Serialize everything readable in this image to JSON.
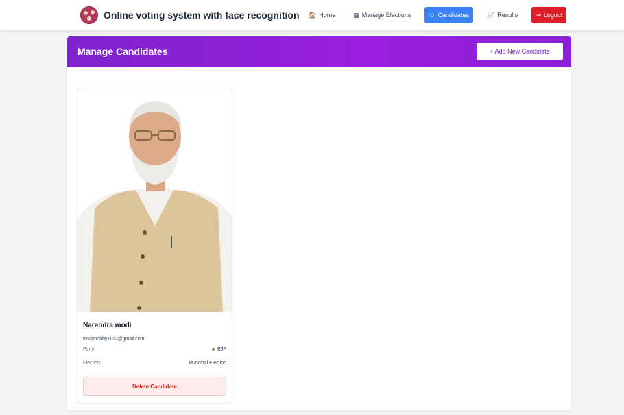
{
  "navbar": {
    "brand_title": "Online voting system with face recognition",
    "links": [
      {
        "label": "Home",
        "icon": "home-icon",
        "glyph": "🏠"
      },
      {
        "label": "Manage Elections",
        "icon": "calendar-icon",
        "glyph": "▦"
      },
      {
        "label": "Candidates",
        "icon": "users-icon",
        "glyph": "☺"
      },
      {
        "label": "Results",
        "icon": "chart-icon",
        "glyph": "📈"
      },
      {
        "label": "Logout",
        "icon": "logout-icon",
        "glyph": "⇥"
      }
    ],
    "active_color": "#3b82f6",
    "logout_color": "#e11d2a"
  },
  "main": {
    "title": "Manage Candidates",
    "add_button": "+ Add New Candidate",
    "header_color": "#7e22ce"
  },
  "candidate": {
    "name": "Narendra modi",
    "email": "vinaybobby1122@gmail.com",
    "party_label": "Party:",
    "party_value": "BJP",
    "election_label": "Election:",
    "election_value": "Muncipal Election",
    "delete_button": "Delete Candidate"
  }
}
